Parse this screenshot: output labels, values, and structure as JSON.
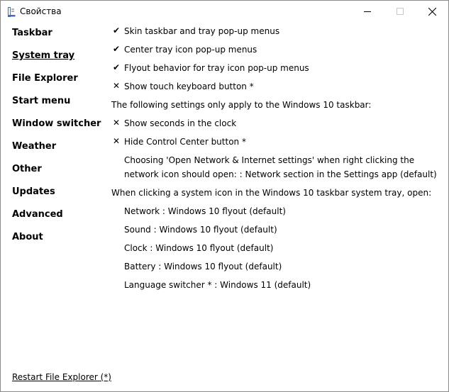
{
  "window": {
    "title": "Свойства"
  },
  "sidebar": {
    "items": [
      {
        "label": "Taskbar"
      },
      {
        "label": "System tray"
      },
      {
        "label": "File Explorer"
      },
      {
        "label": "Start menu"
      },
      {
        "label": "Window switcher"
      },
      {
        "label": "Weather"
      },
      {
        "label": "Other"
      },
      {
        "label": "Updates"
      },
      {
        "label": "Advanced"
      },
      {
        "label": "About"
      }
    ],
    "active_index": 1
  },
  "settings": {
    "skin_taskbar": {
      "mark": "✔",
      "label": "Skin taskbar and tray pop-up menus"
    },
    "center_tray": {
      "mark": "✔",
      "label": "Center tray icon pop-up menus"
    },
    "flyout_behavior": {
      "mark": "✔",
      "label": "Flyout behavior for tray icon pop-up menus"
    },
    "touch_keyboard": {
      "mark": "✕",
      "label": "Show touch keyboard button *"
    },
    "win10_note": "The following settings only apply to the Windows 10 taskbar:",
    "show_seconds": {
      "mark": "✕",
      "label": "Show seconds in the clock"
    },
    "hide_control_center": {
      "mark": "✕",
      "label": "Hide Control Center button *"
    },
    "network_open_line1": "Choosing 'Open Network & Internet settings' when right clicking the",
    "network_open_line2": "network icon should open: : Network section in the Settings app (default)",
    "system_icon_note": "When clicking a system icon in the Windows 10 taskbar system tray, open:",
    "network": "Network : Windows 10 flyout (default)",
    "sound": "Sound : Windows 10 flyout (default)",
    "clock": "Clock : Windows 10 flyout (default)",
    "battery": "Battery : Windows 10 flyout (default)",
    "language": "Language switcher * : Windows 11 (default)"
  },
  "footer": {
    "restart_label": "Restart File Explorer (*)"
  }
}
